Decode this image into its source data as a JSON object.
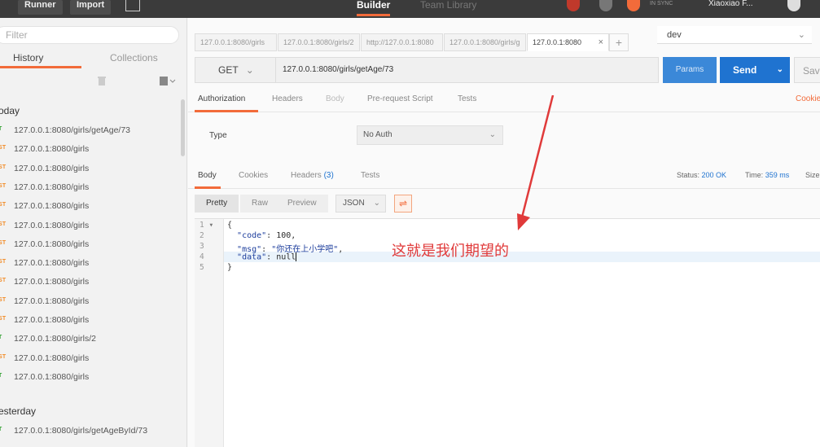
{
  "topbar": {
    "runner_label": "Runner",
    "import_label": "Import",
    "tabs": [
      {
        "label": "Builder",
        "active": true
      },
      {
        "label": "Team Library",
        "active": false
      }
    ],
    "sync_label": "IN SYNC",
    "user_label": "Xiaoxiao F..."
  },
  "sidebar": {
    "filter_placeholder": "Filter",
    "tabs": [
      {
        "label": "History",
        "active": true
      },
      {
        "label": "Collections",
        "active": false
      }
    ],
    "today_label": "oday",
    "yesterday_label": "esterday",
    "today_items": [
      {
        "method": "T",
        "url": "127.0.0.1:8080/girls/getAge/73",
        "type": "get"
      },
      {
        "method": "ST",
        "url": "127.0.0.1:8080/girls",
        "type": "post"
      },
      {
        "method": "ST",
        "url": "127.0.0.1:8080/girls",
        "type": "post"
      },
      {
        "method": "ST",
        "url": "127.0.0.1:8080/girls",
        "type": "post"
      },
      {
        "method": "ST",
        "url": "127.0.0.1:8080/girls",
        "type": "post"
      },
      {
        "method": "ST",
        "url": "127.0.0.1:8080/girls",
        "type": "post"
      },
      {
        "method": "ST",
        "url": "127.0.0.1:8080/girls",
        "type": "post"
      },
      {
        "method": "ST",
        "url": "127.0.0.1:8080/girls",
        "type": "post"
      },
      {
        "method": "ST",
        "url": "127.0.0.1:8080/girls",
        "type": "post"
      },
      {
        "method": "ST",
        "url": "127.0.0.1:8080/girls",
        "type": "post"
      },
      {
        "method": "ST",
        "url": "127.0.0.1:8080/girls",
        "type": "post"
      },
      {
        "method": "T",
        "url": "127.0.0.1:8080/girls/2",
        "type": "get"
      },
      {
        "method": "ST",
        "url": "127.0.0.1:8080/girls",
        "type": "post"
      },
      {
        "method": "T",
        "url": "127.0.0.1:8080/girls",
        "type": "get"
      }
    ],
    "yesterday_items": [
      {
        "method": "T",
        "url": "127.0.0.1:8080/girls/getAgeById/73",
        "type": "get"
      }
    ]
  },
  "request_tabs": [
    {
      "label": "127.0.0.1:8080/girls",
      "active": false
    },
    {
      "label": "127.0.0.1:8080/girls/2",
      "active": false
    },
    {
      "label": "http://127.0.0.1:8080",
      "active": false
    },
    {
      "label": "127.0.0.1:8080/girls/g",
      "active": false
    },
    {
      "label": "127.0.0.1:8080",
      "active": true
    }
  ],
  "environment": "dev",
  "request": {
    "method": "GET",
    "url": "127.0.0.1:8080/girls/getAge/73",
    "params_label": "Params",
    "send_label": "Send",
    "save_label": "Sav"
  },
  "request_subtabs": [
    {
      "label": "Authorization",
      "active": true
    },
    {
      "label": "Headers",
      "active": false
    },
    {
      "label": "Body",
      "active": false
    },
    {
      "label": "Pre-request Script",
      "active": false
    },
    {
      "label": "Tests",
      "active": false
    }
  ],
  "cookies_label": "Cookie",
  "auth": {
    "type_label": "Type",
    "value": "No Auth"
  },
  "response": {
    "tabs": [
      {
        "label": "Body",
        "count": "",
        "active": true
      },
      {
        "label": "Cookies",
        "count": "",
        "active": false
      },
      {
        "label": "Headers",
        "count": "(3)",
        "active": false
      },
      {
        "label": "Tests",
        "count": "",
        "active": false
      }
    ],
    "status_label": "Status:",
    "status_value": "200 OK",
    "time_label": "Time:",
    "time_value": "359 ms",
    "size_label": "Size"
  },
  "viewer": {
    "modes": [
      {
        "label": "Pretty",
        "active": true
      },
      {
        "label": "Raw",
        "active": false
      },
      {
        "label": "Preview",
        "active": false
      }
    ],
    "format": "JSON"
  },
  "code": {
    "line_numbers": [
      "1",
      "2",
      "3",
      "4",
      "5"
    ],
    "open_brace": "{",
    "close_brace": "}",
    "code_key": "\"code\"",
    "code_val": "100",
    "msg_key": "\"msg\"",
    "msg_val": "\"你还在上小学吧\"",
    "data_key": "\"data\"",
    "data_val": "null"
  },
  "annotation": "这就是我们期望的",
  "colors": {
    "accent": "#f26b3a",
    "send": "#1f73d0",
    "annotation": "#e03a3a"
  }
}
